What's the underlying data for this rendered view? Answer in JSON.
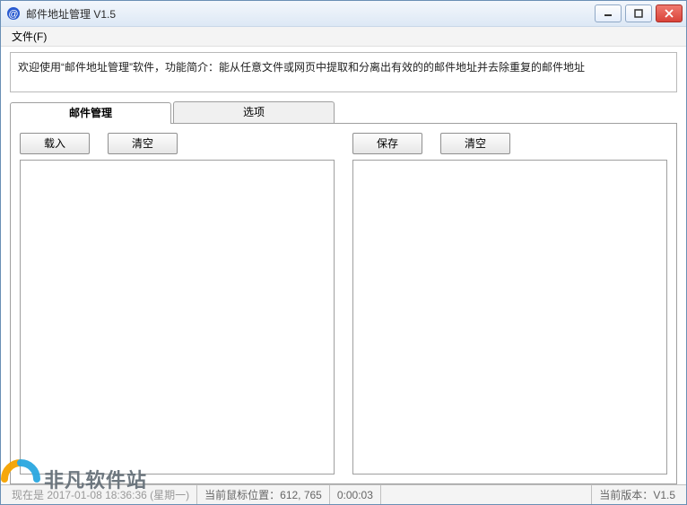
{
  "window": {
    "title": "邮件地址管理 V1.5"
  },
  "menu": {
    "file": "文件(F)"
  },
  "welcome": {
    "text": "欢迎使用“邮件地址管理”软件，功能简介：能从任意文件或网页中提取和分离出有效的的邮件地址并去除重复的邮件地址"
  },
  "tabs": {
    "manage": "邮件管理",
    "options": "选项"
  },
  "buttons": {
    "load": "载入",
    "clear_left": "清空",
    "save": "保存",
    "clear_right": "清空"
  },
  "status": {
    "now_label": "现在是",
    "datetime": "2017-01-08 18:36:36 (星期一)",
    "mouse_label": "当前鼠标位置：",
    "mouse_value": "612, 765",
    "elapsed": "0:00:03",
    "version_label": "当前版本：",
    "version_value": "V1.5"
  },
  "watermark": {
    "text": "非凡软件站"
  }
}
